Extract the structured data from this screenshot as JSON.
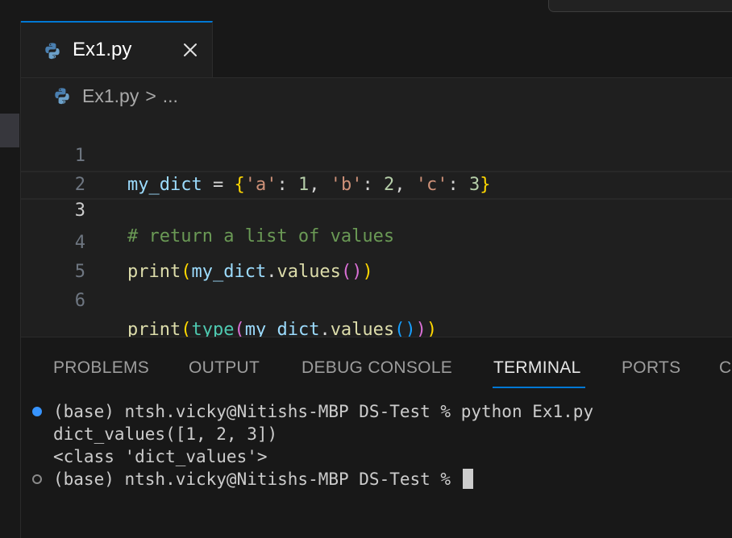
{
  "editor": {
    "tab": {
      "filename": "Ex1.py",
      "close_icon": "close-icon",
      "file_icon": "python-icon"
    },
    "breadcrumb": {
      "file": "Ex1.py",
      "separator": ">",
      "more": "..."
    },
    "lines": [
      {
        "number": "1"
      },
      {
        "number": "2"
      },
      {
        "number": "3"
      },
      {
        "number": "4"
      },
      {
        "number": "5"
      },
      {
        "number": "6"
      }
    ],
    "code": {
      "l1": {
        "var": "my_dict",
        "eq": " = ",
        "ob": "{",
        "k1": "'a'",
        "c1": ": ",
        "v1": "1",
        "s1": ", ",
        "k2": "'b'",
        "c2": ": ",
        "v2": "2",
        "s2": ", ",
        "k3": "'c'",
        "c3": ": ",
        "v3": "3",
        "cb": "}"
      },
      "l3": {
        "comment": "# return a list of values"
      },
      "l4": {
        "fn": "print",
        "op": "(",
        "var": "my_dict",
        "dot": ".",
        "method": "values",
        "p2o": "(",
        "p2c": ")",
        "cp": ")"
      },
      "l6": {
        "fn": "print",
        "op": "(",
        "type": "type",
        "op2": "(",
        "var": "my_dict",
        "dot": ".",
        "method": "values",
        "p3o": "(",
        "p3c": ")",
        "cp2": ")",
        "cp": ")"
      }
    },
    "current_line": 3
  },
  "panel": {
    "tabs": [
      "PROBLEMS",
      "OUTPUT",
      "DEBUG CONSOLE",
      "TERMINAL",
      "PORTS",
      "C"
    ],
    "active_tab": "TERMINAL",
    "terminal": {
      "lines": [
        "(base) ntsh.vicky@Nitishs-MBP DS-Test % python Ex1.py",
        "dict_values([1, 2, 3])",
        "<class 'dict_values'>",
        "(base) ntsh.vicky@Nitishs-MBP DS-Test % "
      ]
    }
  },
  "colors": {
    "accent": "#0078d4",
    "background": "#1f1f1f",
    "panel": "#181818",
    "status_dot": "#3794ff"
  }
}
